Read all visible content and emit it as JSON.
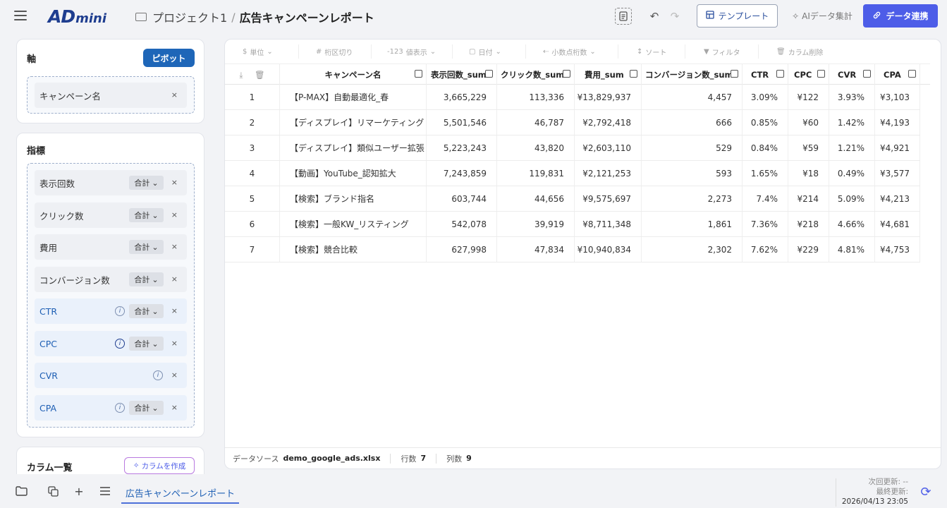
{
  "header": {
    "logo_big": "AD",
    "logo_small": "mini",
    "project": "プロジェクト1",
    "separator": "/",
    "report": "広告キャンペーンレポート",
    "template_label": "テンプレート",
    "ai_label": "AIデータ集計",
    "connect_label": "データ連携"
  },
  "sidebar": {
    "axis_title": "軸",
    "pivot_label": "ピボット",
    "axis_items": [
      {
        "label": "キャンペーン名"
      }
    ],
    "metrics_title": "指標",
    "metrics": [
      {
        "label": "表示回数",
        "agg": "合計"
      },
      {
        "label": "クリック数",
        "agg": "合計"
      },
      {
        "label": "費用",
        "agg": "合計"
      },
      {
        "label": "コンバージョン数",
        "agg": "合計"
      },
      {
        "label": "CTR",
        "agg": "合計"
      },
      {
        "label": "CPC",
        "agg": "合計"
      },
      {
        "label": "CVR",
        "agg": ""
      },
      {
        "label": "CPA",
        "agg": "合計"
      }
    ],
    "columns_title": "カラム一覧",
    "create_column_label": "カラムを作成",
    "remove_symbol": "×"
  },
  "toolbar": {
    "unit": "単位",
    "thousands": "桁区切り",
    "value_display_prefix": "-123",
    "value_display": "値表示",
    "date": "日付",
    "decimals": "小数点桁数",
    "sort": "ソート",
    "filter": "フィルタ",
    "delete_column": "カラム削除"
  },
  "table": {
    "columns": [
      "キャンペーン名",
      "表示回数_sum",
      "クリック数_sum",
      "費用_sum",
      "コンバージョン数_sum",
      "CTR",
      "CPC",
      "CVR",
      "CPA"
    ],
    "rows": [
      [
        "1",
        "【P-MAX】自動最適化_春",
        "3,665,229",
        "113,336",
        "¥13,829,937",
        "4,457",
        "3.09%",
        "¥122",
        "3.93%",
        "¥3,103"
      ],
      [
        "2",
        "【ディスプレイ】リマーケティング",
        "5,501,546",
        "46,787",
        "¥2,792,418",
        "666",
        "0.85%",
        "¥60",
        "1.42%",
        "¥4,193"
      ],
      [
        "3",
        "【ディスプレイ】類似ユーザー拡張",
        "5,223,243",
        "43,820",
        "¥2,603,110",
        "529",
        "0.84%",
        "¥59",
        "1.21%",
        "¥4,921"
      ],
      [
        "4",
        "【動画】YouTube_認知拡大",
        "7,243,859",
        "119,831",
        "¥2,121,253",
        "593",
        "1.65%",
        "¥18",
        "0.49%",
        "¥3,577"
      ],
      [
        "5",
        "【検索】ブランド指名",
        "603,744",
        "44,656",
        "¥9,575,697",
        "2,273",
        "7.4%",
        "¥214",
        "5.09%",
        "¥4,213"
      ],
      [
        "6",
        "【検索】一般KW_リスティング",
        "542,078",
        "39,919",
        "¥8,711,348",
        "1,861",
        "7.36%",
        "¥218",
        "4.66%",
        "¥4,681"
      ],
      [
        "7",
        "【検索】競合比較",
        "627,998",
        "47,834",
        "¥10,940,834",
        "2,302",
        "7.62%",
        "¥229",
        "4.81%",
        "¥4,753"
      ]
    ]
  },
  "footer": {
    "source_label": "データソース",
    "source_file": "demo_google_ads.xlsx",
    "rows_label": "行数",
    "rows_value": "7",
    "cols_label": "列数",
    "cols_value": "9"
  },
  "bottom": {
    "active_tab": "広告キャンペーンレポート",
    "next_update": "次回更新: --",
    "last_update_label": "最終更新:",
    "last_update": "2026/04/13 23:05"
  },
  "colors": {
    "accent": "#4d5de8",
    "pivot": "#1e66b8",
    "metric_blue": "#1e5fb4"
  },
  "icons": [
    "menu-icon",
    "folder-icon",
    "document-icon",
    "undo-icon",
    "redo-icon",
    "template-icon",
    "sparkle-icon",
    "link-icon",
    "download-icon",
    "trash-icon",
    "info-icon",
    "close-icon",
    "chevron-down-icon",
    "copy-icon",
    "plus-icon",
    "refresh-icon"
  ]
}
